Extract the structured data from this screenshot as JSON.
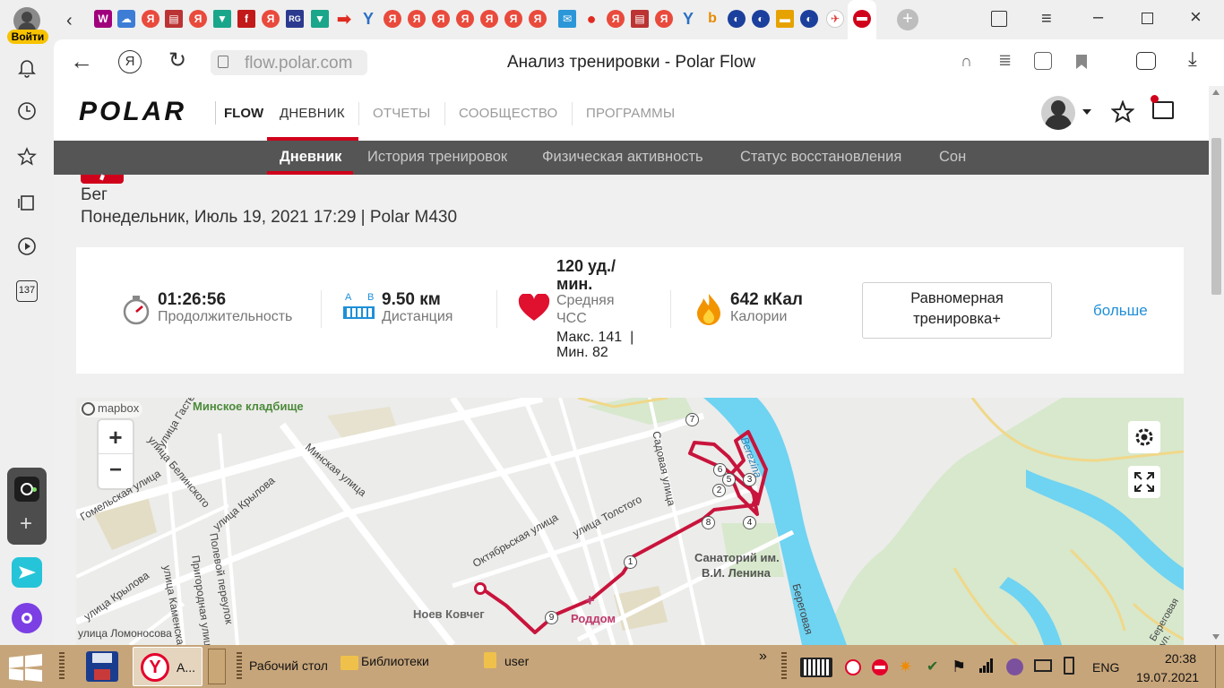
{
  "sidebar": {
    "login_label": "Войти",
    "badge_count": "137"
  },
  "browser": {
    "url": "flow.polar.com",
    "page_title": "Анализ тренировки - Polar Flow"
  },
  "header": {
    "logo_text": "POLAR",
    "flow_label": "FLOW",
    "nav": [
      "ДНЕВНИК",
      "ОТЧЕТЫ",
      "СООБЩЕСТВО",
      "ПРОГРАММЫ"
    ],
    "active_nav": "ДНЕВНИК"
  },
  "subnav": {
    "items": [
      "Дневник",
      "История тренировок",
      "Физическая активность",
      "Статус восстановления",
      "Сон"
    ],
    "active": "Дневник"
  },
  "activity": {
    "sport": "Бег",
    "date_line": "Понедельник, Июль 19, 2021 17:29 | Polar M430"
  },
  "stats": {
    "duration": {
      "value": "01:26:56",
      "label": "Продолжительность"
    },
    "distance": {
      "value": "9.50 км",
      "label": "Дистанция",
      "a": "A",
      "b": "B"
    },
    "hr": {
      "value_line1": "120 уд./",
      "value_line2": "мин.",
      "label_line1": "Средняя",
      "label_line2": "ЧСС",
      "max_line": "Макс. 141  |",
      "min_line": "Мин. 82"
    },
    "calories": {
      "value": "642 кКал",
      "label": "Калории"
    },
    "benefit": {
      "line1": "Равномерная",
      "line2": "тренировка+"
    },
    "more_link": "больше"
  },
  "map": {
    "attribution": "mapbox",
    "zoom_in": "+",
    "zoom_out": "−",
    "labels": {
      "cemetery": "Минское кладбище",
      "gastello": "улица Гастелло",
      "belinsky": "улица Белинского",
      "minsk": "Минская улица",
      "krylova": "улица Крылова",
      "krylova2": "улица Крылова",
      "gomelskaya": "Гомельская улица",
      "polevoy": "Полевой переулок",
      "prigorod": "Пригородная улица",
      "kamenskaya": "улица Каменская",
      "lomonosova": "улица Ломоносова",
      "oktyabr": "Октябрьская улица",
      "tolstogo": "улица Толстого",
      "sadovaya": "Садовая улица",
      "sanatorium1": "Санаторий им.",
      "sanatorium2": "В.И. Ленина",
      "roddom": "Роддом",
      "noev": "Ноев Ковчег",
      "berezina": "Berezina",
      "beregovaya": "Береговая",
      "river_label": "Береговая ул."
    },
    "markers": [
      "1",
      "2",
      "3",
      "4",
      "5",
      "6",
      "7",
      "8",
      "9"
    ],
    "colors": {
      "route": "#c8143c",
      "water": "#6fd3f2",
      "park": "#cfe5c3"
    }
  },
  "taskbar": {
    "app_label": "А...",
    "desktop": "Рабочий стол",
    "libraries": "Библиотеки",
    "user": "user",
    "lang": "ENG",
    "time": "20:38",
    "date": "19.07.2021"
  }
}
